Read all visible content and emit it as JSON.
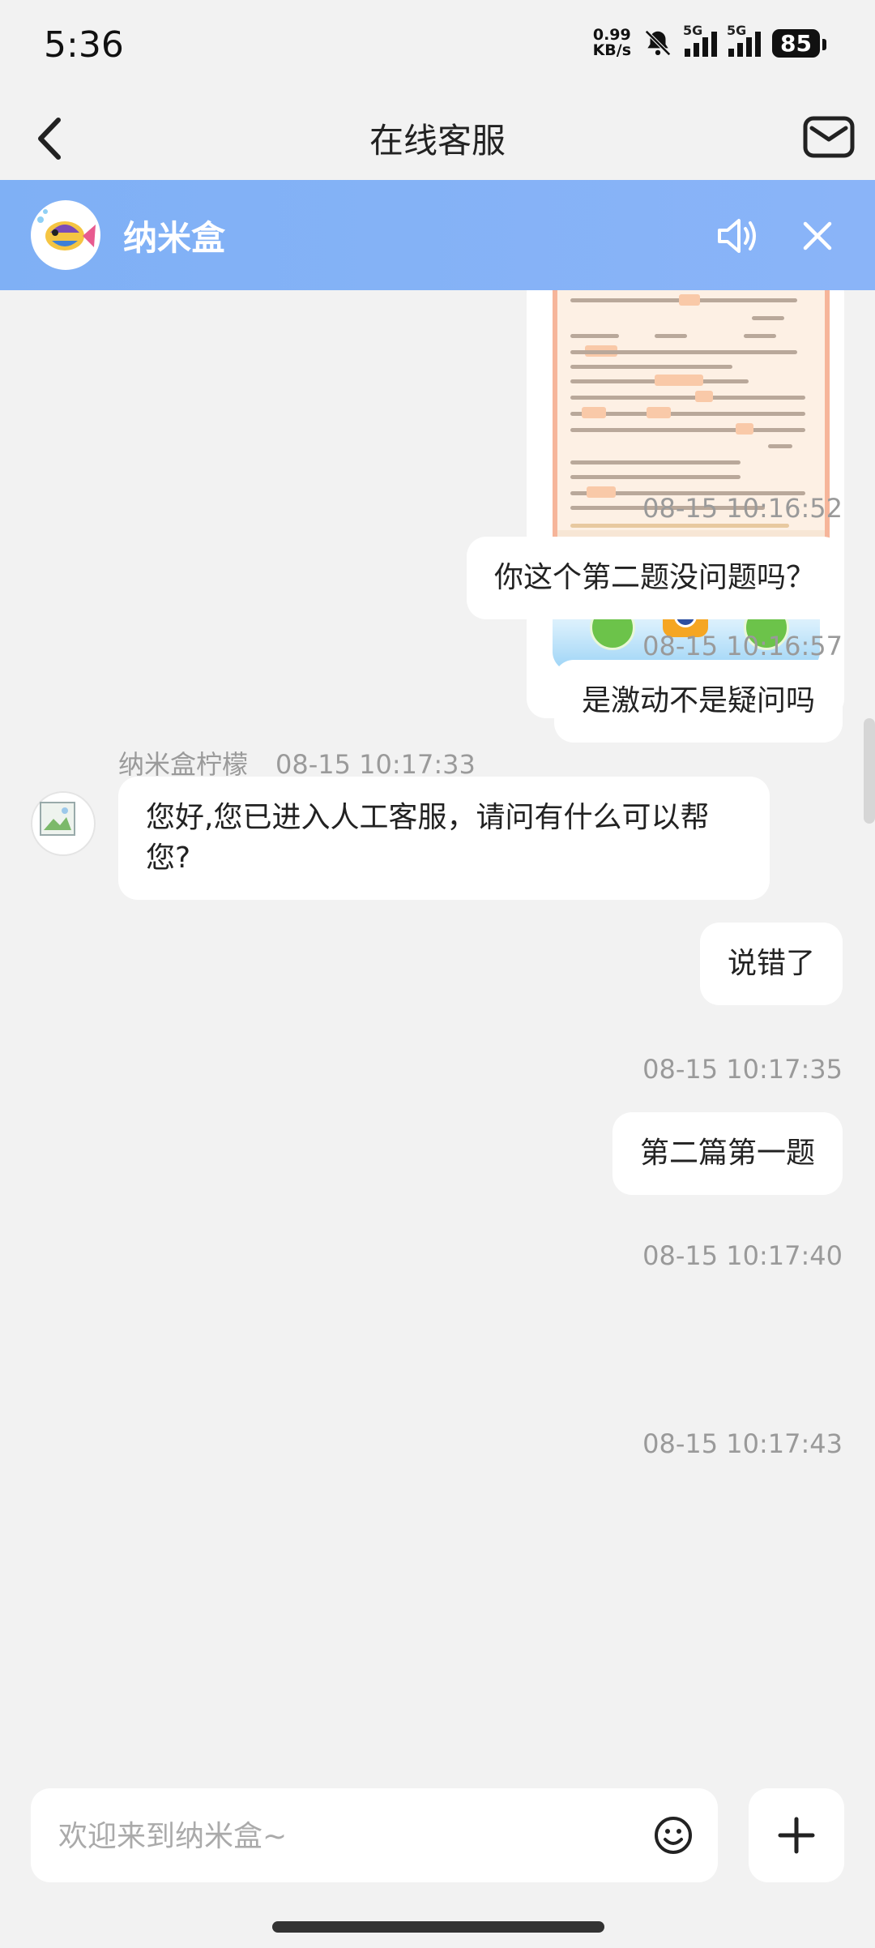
{
  "status_bar": {
    "time": "5:36",
    "net_speed_value": "0.99",
    "net_speed_unit": "KB/s",
    "sim1_label": "5G",
    "sim2_label": "5G",
    "battery": "85"
  },
  "header": {
    "title": "在线客服"
  },
  "banner": {
    "brand_name": "纳米盒",
    "color": "#85b2f6"
  },
  "messages": [
    {
      "timestamp": "08-15 10:16:52",
      "text": "你这个第二题没问题吗？"
    },
    {
      "timestamp": "08-15 10:16:57",
      "text": "是激动不是疑问吗"
    },
    {
      "sender": "纳米盒柠檬",
      "timestamp": "08-15 10:17:33",
      "text": "您好,您已进入人工客服，请问有什么可以帮您?"
    },
    {
      "timestamp": "08-15 10:17:35",
      "text": "说错了"
    },
    {
      "timestamp": "08-15 10:17:40",
      "text": "第二篇第一题"
    },
    {
      "timestamp": "08-15 10:17:43"
    }
  ],
  "input": {
    "placeholder": "欢迎来到纳米盒~"
  }
}
